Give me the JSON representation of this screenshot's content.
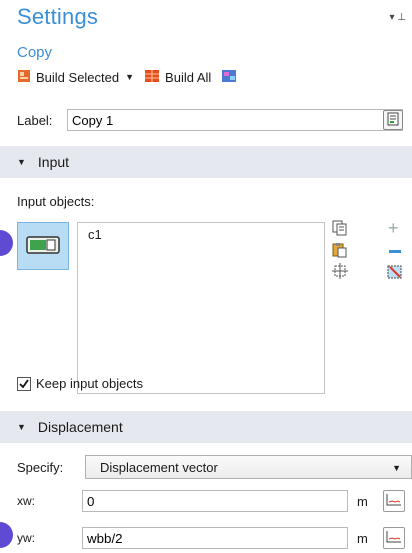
{
  "header": {
    "title": "Settings",
    "subtitle": "Copy"
  },
  "toolbar": {
    "build_selected": "Build Selected",
    "build_all": "Build All"
  },
  "label": {
    "caption": "Label:",
    "value": "Copy 1"
  },
  "input_section": {
    "title": "Input",
    "objects_caption": "Input objects:",
    "objects": [
      "c1"
    ],
    "keep_input_label": "Keep input objects",
    "keep_input_checked": true
  },
  "displacement_section": {
    "title": "Displacement",
    "specify_label": "Specify:",
    "specify_value": "Displacement vector",
    "xw_label": "xw:",
    "xw_value": "0",
    "xw_unit": "m",
    "yw_label": "yw:",
    "yw_value": "wbb/2",
    "yw_unit": "m"
  },
  "colors": {
    "accent": "#3a8fd6",
    "section_bg": "#e5e9ef",
    "selected_bg": "#b9dcf5",
    "marker": "#5f4bd3"
  }
}
